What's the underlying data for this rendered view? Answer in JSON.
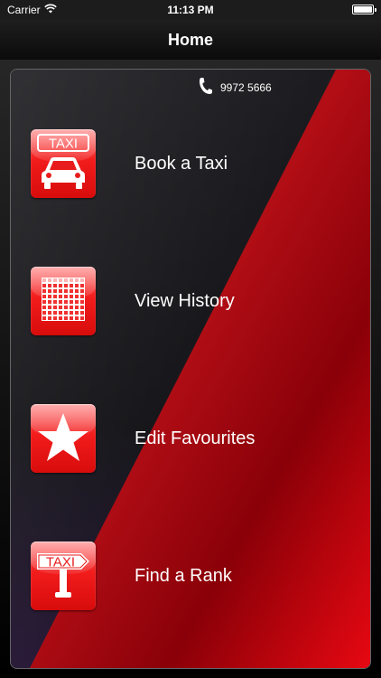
{
  "status_bar": {
    "carrier": "Carrier",
    "time": "11:13 PM",
    "wifi_icon": "wifi-icon",
    "battery_icon": "battery-icon"
  },
  "nav": {
    "title": "Home"
  },
  "contact": {
    "phone_icon": "phone-icon",
    "phone": "9972 5666"
  },
  "menu": {
    "items": [
      {
        "label": "Book a Taxi",
        "icon": "taxi-car-icon",
        "icon_text": "TAXI"
      },
      {
        "label": "View History",
        "icon": "grid-calendar-icon"
      },
      {
        "label": "Edit Favourites",
        "icon": "star-icon"
      },
      {
        "label": "Find a Rank",
        "icon": "taxi-sign-icon",
        "icon_text": "TAXI"
      }
    ]
  },
  "colors": {
    "accent_red": "#e41414",
    "panel_dark": "#0d0d10",
    "text": "#ffffff"
  }
}
